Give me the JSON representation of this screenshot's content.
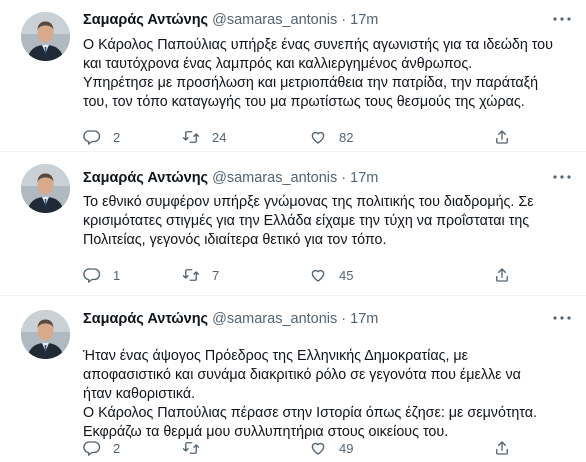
{
  "tweets": [
    {
      "author_name": "Σαμαράς Αντώνης",
      "handle": "@samaras_antonis",
      "separator": "·",
      "time": "17m",
      "lines": [
        "Ο Κάρολος Παπούλιας υπήρξε ένας συνεπής αγωνιστής για τα ιδεώδη του",
        "και ταυτόχρονα ένας λαμπρός και καλλιεργημένος άνθρωπος.",
        "Υπηρέτησε με προσήλωση και μετριοπάθεια την πατρίδα, την παράταξή",
        "του, τον τόπο καταγωγής του μα πρωτίστως τους θεσμούς της χώρας."
      ],
      "replies": "2",
      "retweets": "24",
      "likes": "82"
    },
    {
      "author_name": "Σαμαράς Αντώνης",
      "handle": "@samaras_antonis",
      "separator": "·",
      "time": "17m",
      "lines": [
        "Το εθνικό συμφέρον υπήρξε γνώμονας της πολιτικής του διαδρομής. Σε",
        "κρισιμότατες στιγμές για την Ελλάδα είχαμε την τύχη να προΐσταται της",
        "Πολιτείας, γεγονός ιδιαίτερα θετικό για τον τόπο."
      ],
      "replies": "1",
      "retweets": "7",
      "likes": "45"
    },
    {
      "author_name": "Σαμαράς Αντώνης",
      "handle": "@samaras_antonis",
      "separator": "·",
      "time": "17m",
      "lines": [
        "Ήταν ένας άψογος Πρόεδρος της Ελληνικής Δημοκρατίας, με",
        "αποφασιστικό και συνάμα διακριτικό ρόλο σε γεγονότα που έμελλε να",
        "ήταν καθοριστικά.",
        "Ο Κάρολος Παπούλιας πέρασε στην Ιστορία όπως έζησε: με σεμνότητα.",
        "Εκφράζω τα θερμά μου συλλυπητήρια στους οικείους του."
      ],
      "replies": "2",
      "retweets": "",
      "likes": "49"
    }
  ],
  "icons": {
    "reply": "reply-icon",
    "retweet": "retweet-icon",
    "like": "like-icon",
    "share": "share-icon",
    "more": "more-icon"
  },
  "colors": {
    "text": "#0f1419",
    "secondary": "#536471",
    "divider": "#eff3f4"
  }
}
